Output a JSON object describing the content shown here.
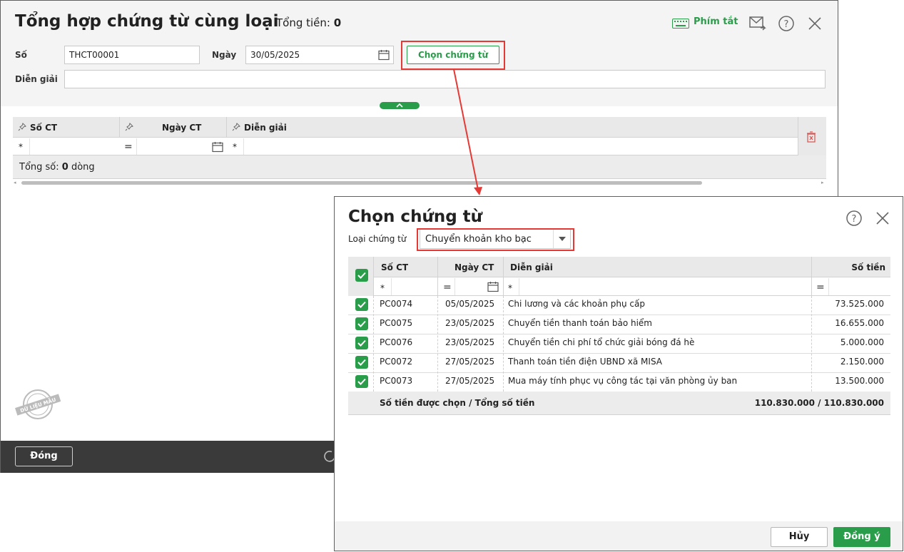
{
  "main": {
    "title": "Tổng hợp chứng từ cùng loại",
    "total_label": "Tổng tiền:",
    "total_value": "0",
    "shortcut_label": "Phím tắt",
    "so_label": "Số",
    "so_value": "THCT00001",
    "ngay_label": "Ngày",
    "ngay_value": "30/05/2025",
    "choose_button": "Chọn chứng từ",
    "dien_giai_label": "Diễn giải",
    "dien_giai_value": "",
    "grid": {
      "columns": [
        "Số CT",
        "Ngày CT",
        "Diễn giải"
      ],
      "filter_ops": [
        "*",
        "=",
        "*"
      ],
      "summary_prefix": "Tổng số:",
      "summary_count": "0",
      "summary_suffix": "dòng"
    },
    "close_button": "Đóng",
    "watermark": "DỮ LIỆU MẪU"
  },
  "dialog": {
    "title": "Chọn chứng từ",
    "type_label": "Loại chứng từ",
    "type_value": "Chuyển khoản kho bạc",
    "columns": {
      "so_ct": "Số CT",
      "ngay_ct": "Ngày CT",
      "dien_giai": "Diễn giải",
      "so_tien": "Số tiền"
    },
    "filter_ops": {
      "so_ct": "*",
      "ngay_ct": "=",
      "dien_giai": "*",
      "so_tien": "="
    },
    "rows": [
      {
        "so_ct": "PC0074",
        "ngay_ct": "05/05/2025",
        "dien_giai": "Chi lương và các khoản phụ cấp",
        "so_tien": "73.525.000",
        "checked": true
      },
      {
        "so_ct": "PC0075",
        "ngay_ct": "23/05/2025",
        "dien_giai": "Chuyển tiền thanh toán bảo hiểm",
        "so_tien": "16.655.000",
        "checked": true
      },
      {
        "so_ct": "PC0076",
        "ngay_ct": "23/05/2025",
        "dien_giai": "Chuyển tiền chi phí tổ chức giải bóng đá hè",
        "so_tien": "5.000.000",
        "checked": true
      },
      {
        "so_ct": "PC0072",
        "ngay_ct": "27/05/2025",
        "dien_giai": "Thanh toán tiền điện UBND xã MISA",
        "so_tien": "2.150.000",
        "checked": true
      },
      {
        "so_ct": "PC0073",
        "ngay_ct": "27/05/2025",
        "dien_giai": "Mua máy tính phục vụ công tác tại văn phòng ủy ban",
        "so_tien": "13.500.000",
        "checked": true
      }
    ],
    "summary_label": "Số tiền được chọn / Tổng số tiền",
    "summary_value": "110.830.000 / 110.830.000",
    "cancel_button": "Hủy",
    "ok_button": "Đồng ý"
  },
  "colors": {
    "accent_green": "#2a9d4b",
    "highlight_red": "#e53935",
    "footer_dark": "#3a3a3a"
  },
  "icons": [
    "keyboard-icon",
    "mail-forward-icon",
    "help-icon",
    "close-icon",
    "calendar-icon",
    "chevron-up-icon",
    "pin-icon",
    "delete-icon",
    "dropdown-arrow-icon",
    "checkbox-checked-icon",
    "refresh-icon"
  ]
}
